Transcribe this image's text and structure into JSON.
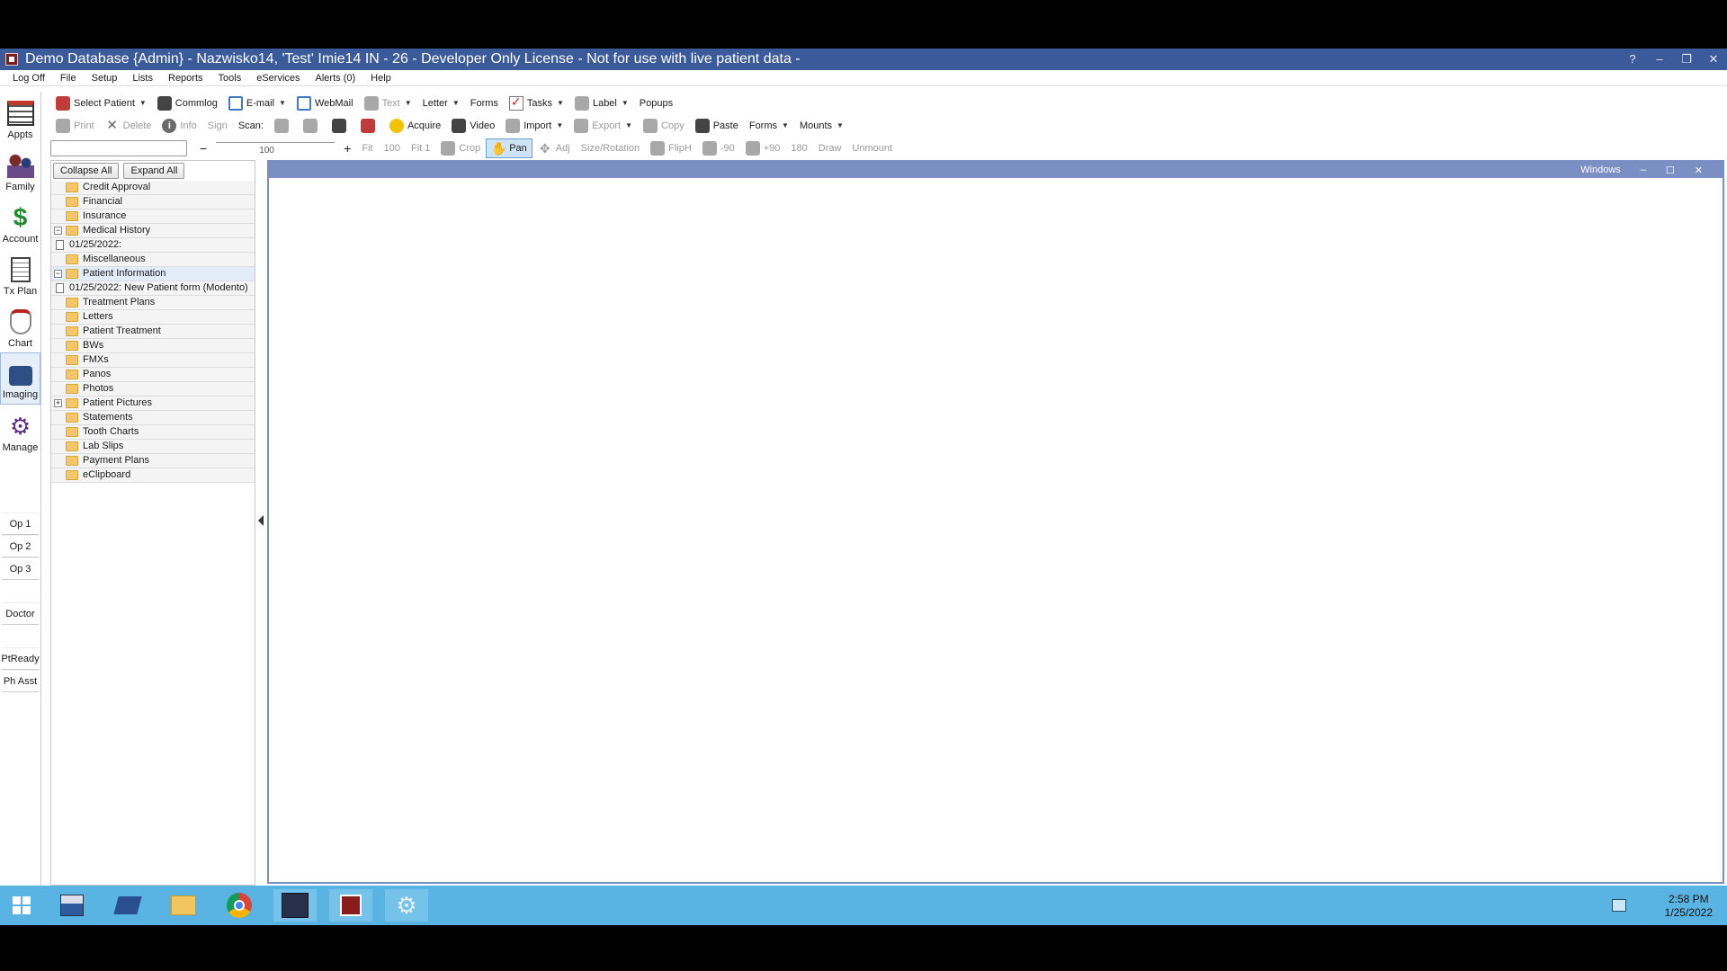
{
  "window": {
    "title": "Demo Database {Admin} - Nazwisko14, 'Test' Imie14 IN - 26 - Developer Only License - Not for use with live patient data -",
    "controls": [
      "?",
      "–",
      "❐",
      "✕"
    ]
  },
  "menu": [
    "Log Off",
    "File",
    "Setup",
    "Lists",
    "Reports",
    "Tools",
    "eServices",
    "Alerts (0)",
    "Help"
  ],
  "toolbar1": {
    "select_patient": "Select Patient",
    "commlog": "Commlog",
    "email": "E-mail",
    "webmail": "WebMail",
    "text": "Text",
    "letter": "Letter",
    "forms": "Forms",
    "tasks": "Tasks",
    "label": "Label",
    "popups": "Popups"
  },
  "toolbar2": {
    "print": "Print",
    "delete": "Delete",
    "info": "Info",
    "sign": "Sign",
    "scan": "Scan:",
    "acquire": "Acquire",
    "video": "Video",
    "import": "Import",
    "export": "Export",
    "copy": "Copy",
    "paste": "Paste",
    "forms": "Forms",
    "mounts": "Mounts"
  },
  "toolbar3": {
    "zoom_value": "100",
    "fit": "Fit",
    "z100": "100",
    "fit1": "Fit 1",
    "crop": "Crop",
    "pan": "Pan",
    "adj": "Adj",
    "size_rotation": "Size/Rotation",
    "fliph": "FlipH",
    "rot_minus90": "-90",
    "rot_plus90": "+90",
    "rot_180": "180",
    "draw": "Draw",
    "unmount": "Unmount"
  },
  "left_nav": [
    {
      "label": "Appts"
    },
    {
      "label": "Family"
    },
    {
      "label": "Account"
    },
    {
      "label": "Tx Plan"
    },
    {
      "label": "Chart"
    },
    {
      "label": "Imaging"
    },
    {
      "label": "Manage"
    }
  ],
  "ops": [
    "Op 1",
    "Op 2",
    "Op 3",
    "Doctor",
    "PtReady",
    "Ph Asst"
  ],
  "tree": {
    "collapse_all": "Collapse All",
    "expand_all": "Expand All",
    "items": [
      {
        "label": "Credit Approval"
      },
      {
        "label": "Financial"
      },
      {
        "label": "Insurance"
      },
      {
        "label": "Medical History",
        "exp": "−"
      },
      {
        "label": "01/25/2022:"
      },
      {
        "label": "Miscellaneous"
      },
      {
        "label": "Patient Information",
        "exp": "−"
      },
      {
        "label": "01/25/2022: New Patient form (Modento)"
      },
      {
        "label": "Treatment Plans"
      },
      {
        "label": "Letters"
      },
      {
        "label": "Patient Treatment"
      },
      {
        "label": "BWs"
      },
      {
        "label": "FMXs"
      },
      {
        "label": "Panos"
      },
      {
        "label": "Photos"
      },
      {
        "label": "Patient Pictures",
        "exp": "+"
      },
      {
        "label": "Statements"
      },
      {
        "label": "Tooth Charts"
      },
      {
        "label": "Lab Slips"
      },
      {
        "label": "Payment Plans"
      },
      {
        "label": "eClipboard"
      }
    ]
  },
  "viewer": {
    "header": "Windows",
    "controls": [
      "–",
      "☐",
      "✕"
    ]
  },
  "taskbar": {
    "time": "2:58 PM",
    "date": "1/25/2022"
  }
}
